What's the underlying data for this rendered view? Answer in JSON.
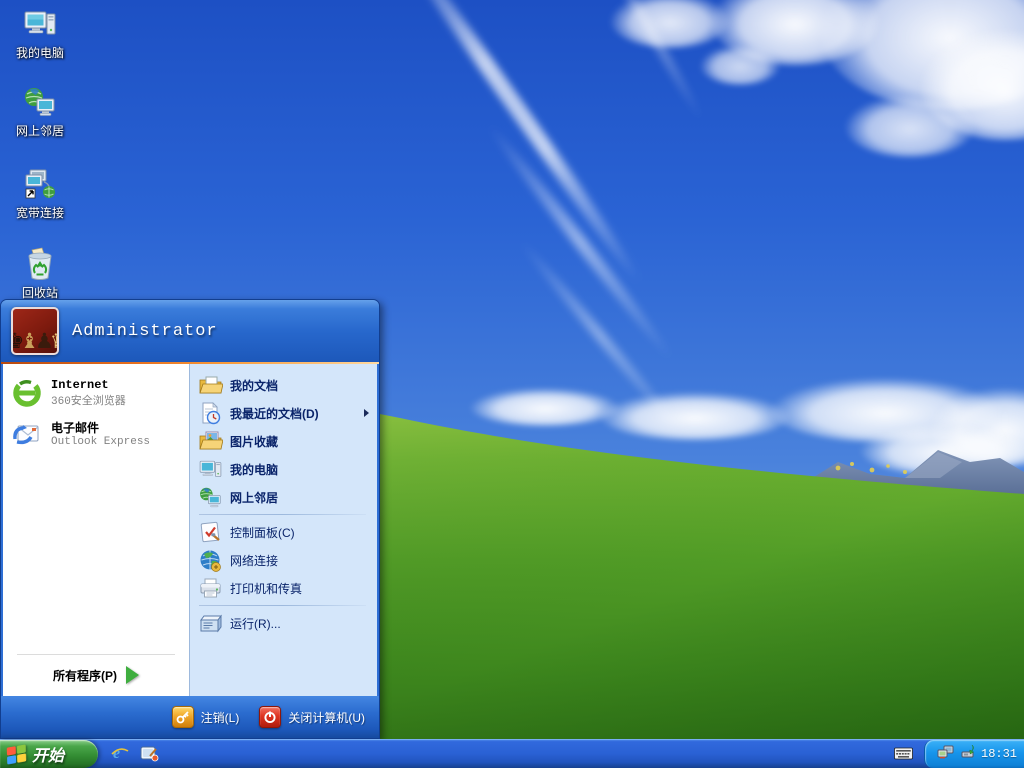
{
  "desktop": {
    "icons": [
      {
        "label": "我的电脑",
        "icon": "my-computer-icon"
      },
      {
        "label": "网上邻居",
        "icon": "network-places-icon"
      },
      {
        "label": "宽带连接",
        "icon": "broadband-connection-icon"
      },
      {
        "label": "回收站",
        "icon": "recycle-bin-icon"
      }
    ]
  },
  "start_menu": {
    "user_name": "Administrator",
    "pinned": [
      {
        "title": "Internet",
        "subtitle": "360安全浏览器",
        "icon": "browser-360-icon"
      },
      {
        "title": "电子邮件",
        "subtitle": "Outlook Express",
        "icon": "outlook-express-icon"
      }
    ],
    "all_programs_label": "所有程序(P)",
    "right_items": [
      {
        "label": "我的文档",
        "icon": "my-documents-icon"
      },
      {
        "label": "我最近的文档(D)",
        "icon": "recent-documents-icon",
        "has_submenu": true
      },
      {
        "label": "图片收藏",
        "icon": "my-pictures-icon"
      },
      {
        "label": "我的电脑",
        "icon": "my-computer-icon"
      },
      {
        "label": "网上邻居",
        "icon": "network-places-icon"
      },
      {
        "label": "控制面板(C)",
        "icon": "control-panel-icon"
      },
      {
        "label": "网络连接",
        "icon": "network-connections-icon"
      },
      {
        "label": "打印机和传真",
        "icon": "printers-faxes-icon"
      },
      {
        "label": "运行(R)...",
        "icon": "run-icon"
      }
    ],
    "footer": {
      "log_off_label": "注销(L)",
      "turn_off_label": "关闭计算机(U)"
    }
  },
  "taskbar": {
    "start_label": "开始",
    "quick_launch": [
      {
        "icon": "internet-explorer-icon"
      },
      {
        "icon": "show-desktop-icon"
      }
    ],
    "tray": {
      "input_method_icon": "keyboard-icon",
      "icons": [
        "network-status-icon",
        "safely-remove-icon"
      ],
      "clock": "18:31"
    }
  },
  "colors": {
    "taskbar_blue": "#2a61d4",
    "start_button_green": "#348e34",
    "tray_blue": "#1795ec",
    "menu_header_blue": "#2767cc",
    "menu_right_bg": "#d4e6fa",
    "menu_text_navy": "#0a246a",
    "orange_divider": "#e66f1e",
    "sky_blue": "#2a63d4",
    "hill_green": "#4d9424"
  }
}
